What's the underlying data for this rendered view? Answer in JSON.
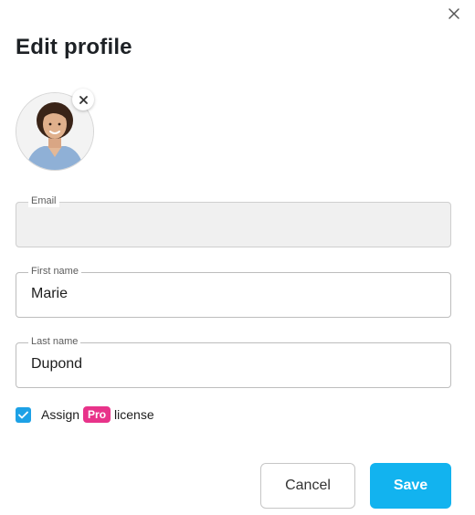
{
  "dialog": {
    "title": "Edit profile",
    "close_icon": "close-icon"
  },
  "avatar": {
    "remove_icon": "close-icon"
  },
  "fields": {
    "email": {
      "label": "Email",
      "value": ""
    },
    "first_name": {
      "label": "First name",
      "value": "Marie"
    },
    "last_name": {
      "label": "Last name",
      "value": "Dupond"
    }
  },
  "license": {
    "checked": true,
    "text_before": "Assign",
    "badge": "Pro",
    "text_after": "license"
  },
  "buttons": {
    "cancel": "Cancel",
    "save": "Save"
  },
  "colors": {
    "accent": "#12b3ef",
    "checkbox": "#1da1e6",
    "pro_badge": "#e8338a"
  }
}
